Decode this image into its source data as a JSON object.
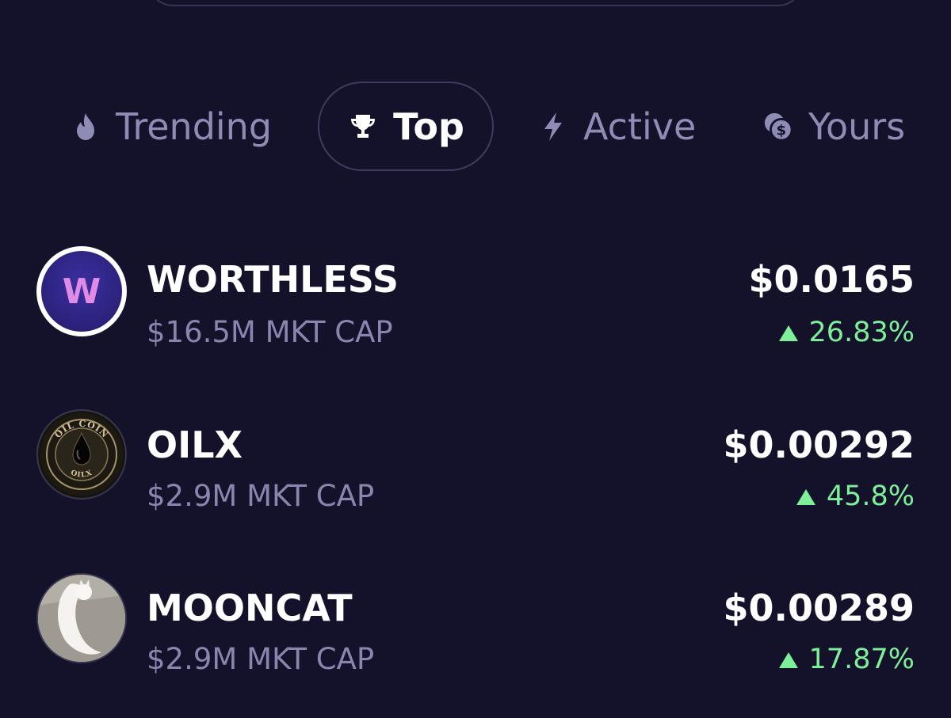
{
  "colors": {
    "background": "#13122a",
    "tab_inactive": "#8e8cb4",
    "tab_border": "#3d3c60",
    "subtext": "#8886ae",
    "positive": "#7ef09a"
  },
  "tabs": [
    {
      "label": "Trending",
      "icon": "flame-icon",
      "selected": false
    },
    {
      "label": "Top",
      "icon": "trophy-icon",
      "selected": true
    },
    {
      "label": "Active",
      "icon": "lightning-icon",
      "selected": false
    },
    {
      "label": "Yours",
      "icon": "coins-icon",
      "selected": false
    }
  ],
  "tokens": [
    {
      "name": "WORTHLESS",
      "market_cap": "$16.5M MKT CAP",
      "price": "$0.0165",
      "change": "26.83%",
      "avatar": "worthless-logo",
      "avatar_text": "W"
    },
    {
      "name": "OILX",
      "market_cap": "$2.9M MKT CAP",
      "price": "$0.00292",
      "change": "45.8%",
      "avatar": "oil-coin-logo",
      "avatar_top_text": "OIL COIN",
      "avatar_bottom_text": "OILX"
    },
    {
      "name": "MOONCAT",
      "market_cap": "$2.9M MKT CAP",
      "price": "$0.00289",
      "change": "17.87%",
      "avatar": "mooncat-photo"
    }
  ]
}
